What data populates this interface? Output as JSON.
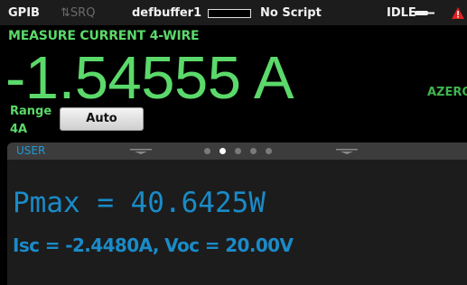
{
  "status_bar": {
    "interface": "GPIB",
    "srq": "SRQ",
    "buffer_name": "defbuffer1",
    "script": "No Script",
    "state": "IDLE",
    "icons": [
      "srq-arrows-icon",
      "buffer-fill-icon",
      "idle-plug-icon",
      "warning-icon"
    ]
  },
  "measure": {
    "function_label": "MEASURE CURRENT 4-WIRE",
    "reading": "-1.54555 A",
    "azero": "AZERO",
    "range_label": "Range",
    "range_value": "4A",
    "range_button": "Auto"
  },
  "swipe": {
    "title": "USER",
    "page_count": 5,
    "active_page": 2,
    "pmax_line": "Pmax = 40.6425W",
    "isc_voc_line": "Isc = -2.4480A, Voc = 20.00V"
  },
  "colors": {
    "reading_green": "#5bd96a",
    "user_blue": "#1a8bc9",
    "warning_red": "#e02020"
  }
}
